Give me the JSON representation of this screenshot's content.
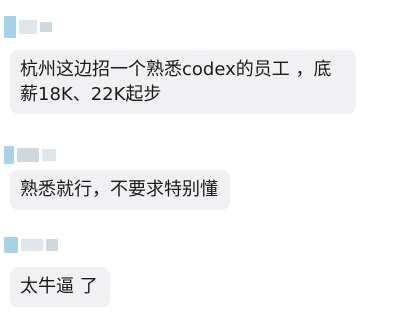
{
  "messages": [
    {
      "text": "杭州这边招一个熟悉codex的员工 ，底薪18K、22K起步"
    },
    {
      "text": "熟悉就行，不要求特别懂"
    },
    {
      "text": "太牛逼 了"
    }
  ],
  "colors": {
    "bubble": "#f1f1f3",
    "text": "#1a1a1a",
    "avatar_blur_a": "#a7d3e6",
    "avatar_blur_b": "#cfd8dc",
    "avatar_blur_c": "#dfe5e8"
  }
}
